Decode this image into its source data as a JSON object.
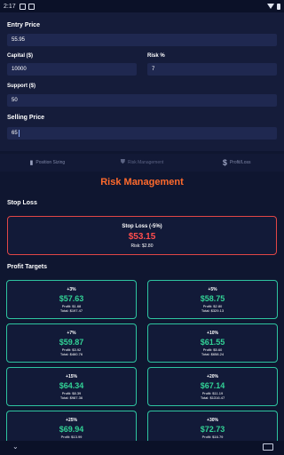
{
  "status": {
    "time": "2:17"
  },
  "form": {
    "entry_label": "Entry Price",
    "entry_value": "55.95",
    "capital_label": "Capital ($)",
    "capital_value": "10000",
    "risk_label": "Risk %",
    "risk_value": "7",
    "support_label": "Support ($)",
    "support_value": "50",
    "selling_label": "Selling Price",
    "selling_value": "65"
  },
  "tabs": [
    {
      "label": "Position Sizing",
      "icon": "bar-chart-icon"
    },
    {
      "label": "Risk Management",
      "icon": "shield-icon"
    },
    {
      "label": "Profit/Loss",
      "icon": "dollar-icon"
    }
  ],
  "risk": {
    "title": "Risk Management",
    "stop_loss_heading": "Stop Loss",
    "stop_label": "Stop Loss (-5%)",
    "stop_price": "$53.15",
    "stop_risk": "Risk: $2.80",
    "profit_targets_heading": "Profit Targets",
    "targets": [
      {
        "pct": "+3%",
        "price": "$57.63",
        "profit": "Profit: $1.68",
        "total": "Total: $197.47"
      },
      {
        "pct": "+5%",
        "price": "$58.75",
        "profit": "Profit: $2.80",
        "total": "Total: $329.13"
      },
      {
        "pct": "+7%",
        "price": "$59.87",
        "profit": "Profit: $3.92",
        "total": "Total: $460.76"
      },
      {
        "pct": "+10%",
        "price": "$61.55",
        "profit": "Profit: $5.60",
        "total": "Total: $658.24"
      },
      {
        "pct": "+15%",
        "price": "$64.34",
        "profit": "Profit: $8.39",
        "total": "Total: $987.36"
      },
      {
        "pct": "+20%",
        "price": "$67.14",
        "profit": "Profit: $11.19",
        "total": "Total: $1316.47"
      },
      {
        "pct": "+25%",
        "price": "$69.94",
        "profit": "Profit: $13.99",
        "total": ""
      },
      {
        "pct": "+30%",
        "price": "$72.73",
        "profit": "Profit: $16.79",
        "total": ""
      }
    ]
  },
  "colors": {
    "accent": "#ff6a2c",
    "loss": "#ff4d4d",
    "gain": "#32d296",
    "card_border": "#2ec4a0"
  }
}
